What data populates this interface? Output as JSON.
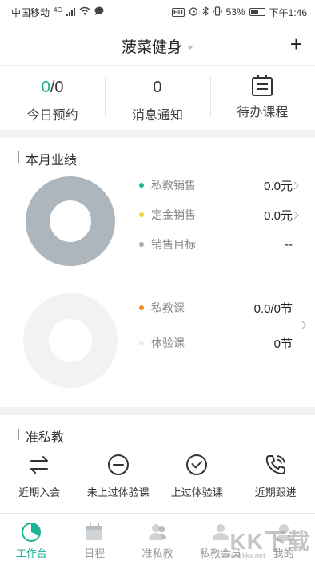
{
  "status_bar": {
    "carrier": "中国移动",
    "network": "4G",
    "battery": "53%",
    "time": "下午1:46"
  },
  "header": {
    "title": "菠菜健身",
    "add_icon": "plus-icon"
  },
  "top_stats": [
    {
      "value_highlight": "0",
      "value_rest": "/0",
      "label": "今日预约"
    },
    {
      "value": "0",
      "label": "消息通知"
    },
    {
      "icon": "calendar-list-icon",
      "label": "待办课程"
    }
  ],
  "monthly": {
    "title": "本月业绩",
    "sales": [
      {
        "name": "私教销售",
        "value": "0.0元",
        "color": "#1bb394"
      },
      {
        "name": "定金销售",
        "value": "0.0元",
        "color": "#f5d33a"
      },
      {
        "name": "销售目标",
        "value": "--",
        "color": "#a7a7a7"
      }
    ],
    "courses": [
      {
        "name": "私教课",
        "value": "0.0/0节",
        "color": "#f08a1c"
      },
      {
        "name": "体验课",
        "value": "0节",
        "color": "#eeeeee"
      }
    ],
    "donut1_color": "#adb6bc",
    "donut2_color": "#f1f2f3"
  },
  "quasi_private": {
    "title": "准私教",
    "actions": [
      {
        "icon": "swap-icon",
        "label": "近期入会"
      },
      {
        "icon": "minus-circle-icon",
        "label": "未上过体验课"
      },
      {
        "icon": "check-circle-icon",
        "label": "上过体验课"
      },
      {
        "icon": "phone-icon",
        "label": "近期跟进"
      }
    ]
  },
  "tabs": [
    {
      "label": "工作台",
      "active": true
    },
    {
      "label": "日程"
    },
    {
      "label": "准私教"
    },
    {
      "label": "私教会员"
    },
    {
      "label": "我的"
    }
  ],
  "watermark": {
    "text": "KK下载",
    "url": "www.kkx.net"
  }
}
